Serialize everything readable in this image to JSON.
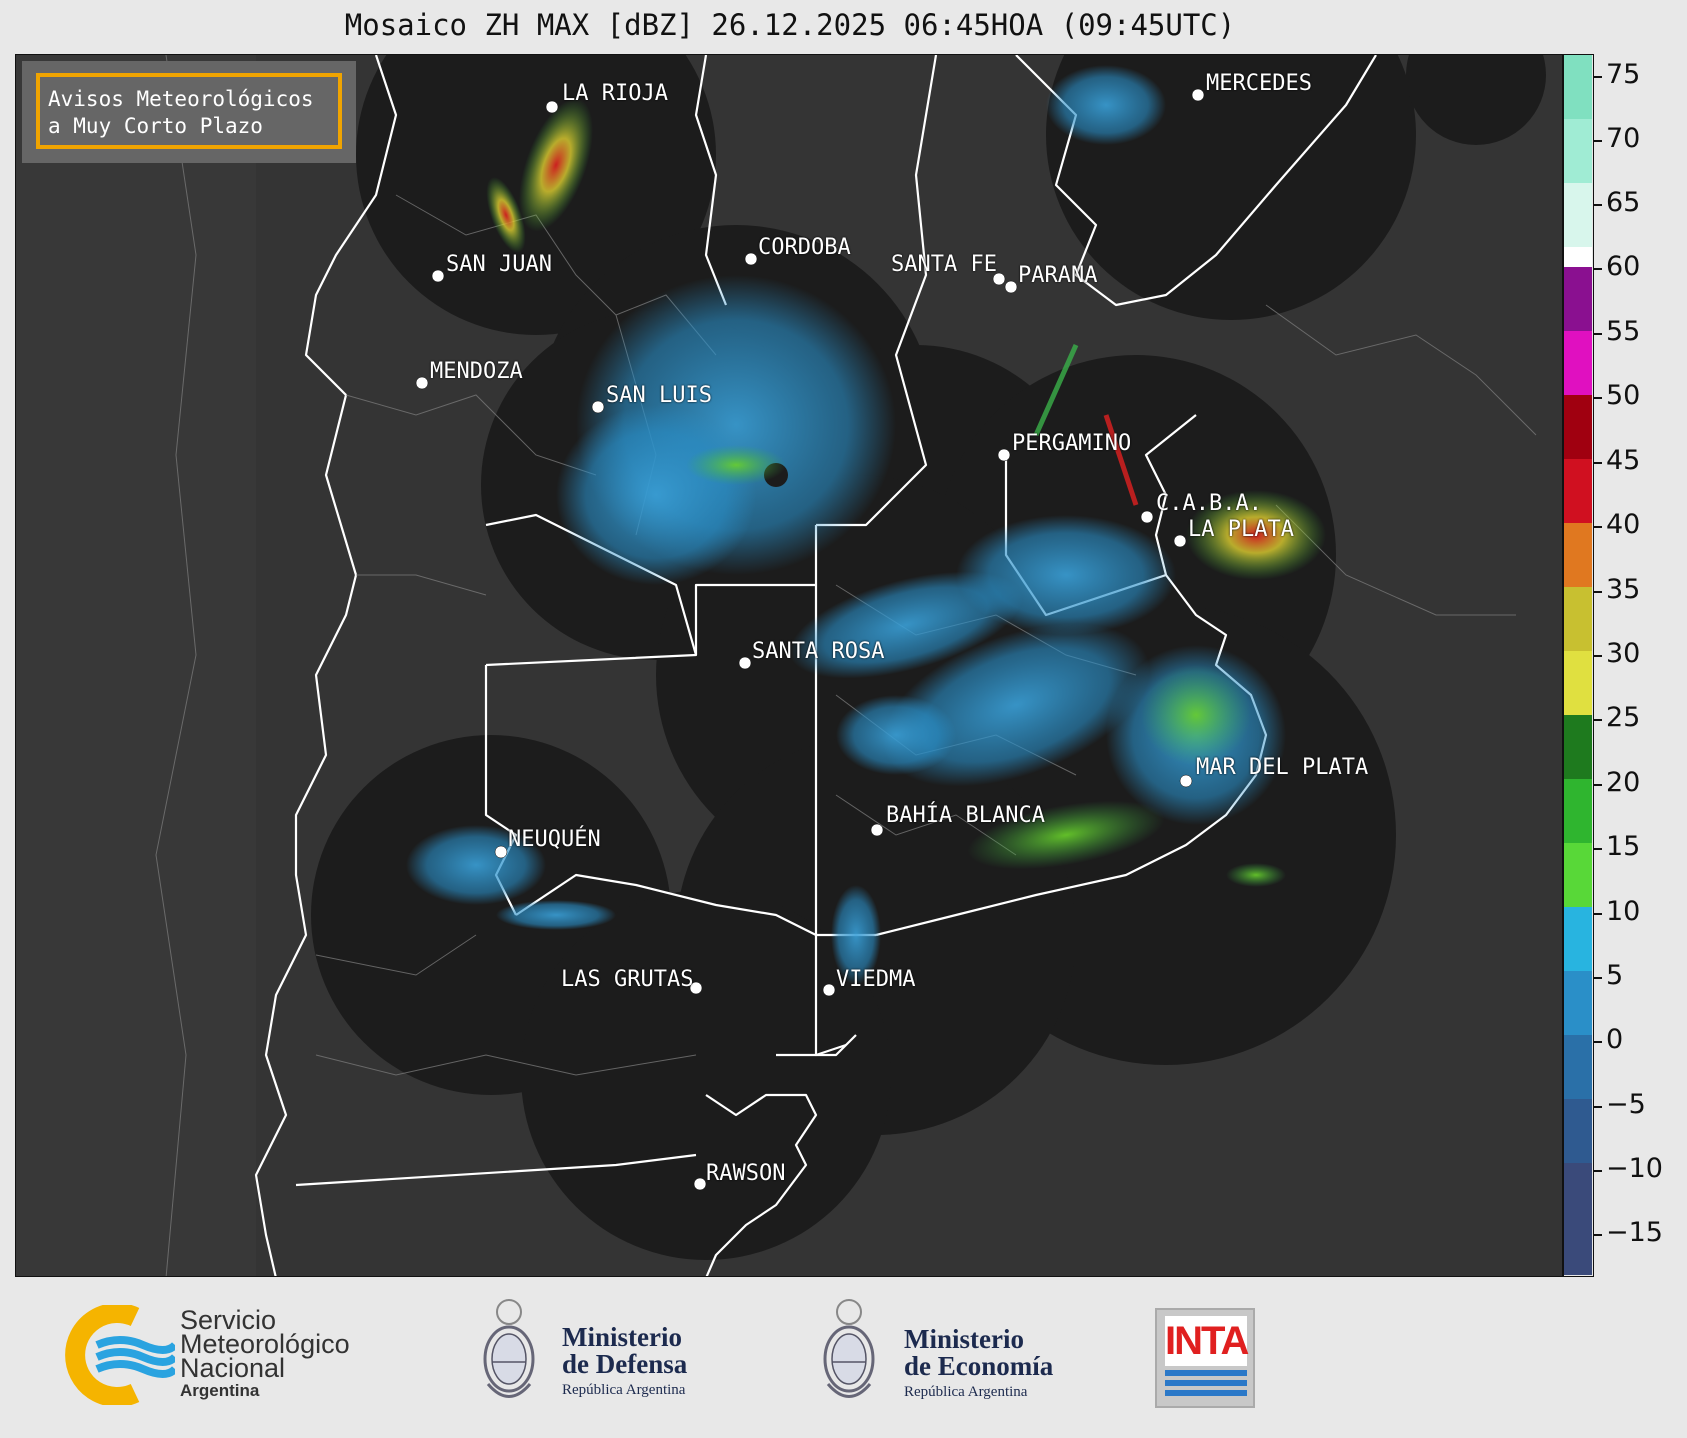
{
  "title": "Mosaico ZH MAX [dBZ] 26.12.2025 06:45HOA (09:45UTC)",
  "alert_box": {
    "line1": "Avisos Meteorológicos",
    "line2": "a Muy Corto Plazo",
    "border_color": "#f0a400"
  },
  "cities": [
    {
      "name": "LA RIOJA"
    },
    {
      "name": "MERCEDES"
    },
    {
      "name": "CORDOBA"
    },
    {
      "name": "SAN JUAN"
    },
    {
      "name": "SANTA FE"
    },
    {
      "name": "PARANA"
    },
    {
      "name": "MENDOZA"
    },
    {
      "name": "SAN LUIS"
    },
    {
      "name": "PERGAMINO"
    },
    {
      "name": "C.A.B.A."
    },
    {
      "name": "LA PLATA"
    },
    {
      "name": "SANTA ROSA"
    },
    {
      "name": "MAR DEL PLATA"
    },
    {
      "name": "BAHÍA BLANCA"
    },
    {
      "name": "NEUQUÉN"
    },
    {
      "name": "LAS GRUTAS"
    },
    {
      "name": "VIEDMA"
    },
    {
      "name": "RAWSON"
    }
  ],
  "colorbar": {
    "unit": "dBZ",
    "labels": [
      "75",
      "70",
      "65",
      "60",
      "55",
      "50",
      "45",
      "40",
      "35",
      "30",
      "25",
      "20",
      "15",
      "10",
      "5",
      "0",
      "−5",
      "−10",
      "−15"
    ],
    "range": [
      -18,
      77
    ],
    "colors": {
      "low": "#3a4a7a",
      "blue": "#2a8fc8",
      "cyan": "#28b4e0",
      "green": "#2fb52f",
      "yellow": "#e0e040",
      "orange": "#e07820",
      "red": "#d01020",
      "darkred": "#a00010",
      "magenta": "#e010c0",
      "purple": "#8a1090",
      "white": "#ffffff",
      "mint": "#80e0c0"
    }
  },
  "logos": {
    "smn": {
      "line1": "Servicio",
      "line2": "Meteorológico",
      "line3": "Nacional",
      "line4": "Argentina"
    },
    "defensa": {
      "line1": "Ministerio",
      "line2": "de Defensa",
      "line3": "República Argentina"
    },
    "economia": {
      "line1": "Ministerio",
      "line2": "de Economía",
      "line3": "República Argentina"
    },
    "inta": {
      "text": "INTA"
    }
  }
}
